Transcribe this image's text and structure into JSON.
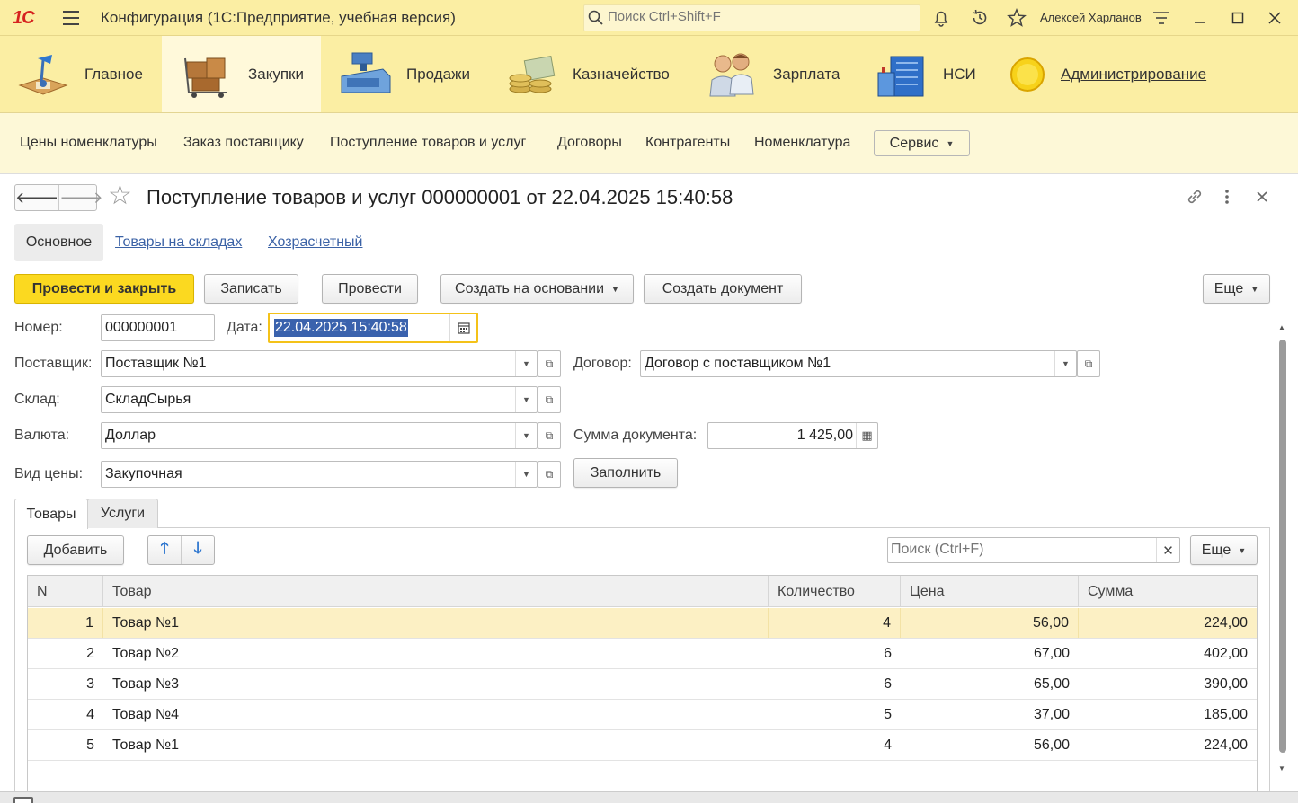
{
  "titlebar": {
    "logo": "1С",
    "title": "Конфигурация  (1С:Предприятие, учебная версия)",
    "search_placeholder": "Поиск Ctrl+Shift+F",
    "user": "Алексей Харланов"
  },
  "sections": [
    {
      "label": "Главное"
    },
    {
      "label": "Закупки"
    },
    {
      "label": "Продажи"
    },
    {
      "label": "Казначейство"
    },
    {
      "label": "Зарплата"
    },
    {
      "label": "НСИ"
    },
    {
      "label": "Администрирование"
    }
  ],
  "nav": {
    "links": [
      "Цены номенклатуры",
      "Заказ поставщику",
      "Поступление товаров и услуг",
      "Договоры",
      "Контрагенты",
      "Номенклатура"
    ],
    "service": "Сервис"
  },
  "form": {
    "title": "Поступление товаров и услуг 000000001 от 22.04.2025 15:40:58",
    "tabs": [
      "Основное",
      "Товары на складах",
      "Хозрасчетный"
    ],
    "buttons": {
      "post_close": "Провести и закрыть",
      "save": "Записать",
      "post": "Провести",
      "create_based": "Создать на основании",
      "create_doc": "Создать документ",
      "more": "Еще"
    },
    "fields": {
      "number_label": "Номер:",
      "number": "000000001",
      "date_label": "Дата:",
      "date": "22.04.2025 15:40:58",
      "supplier_label": "Поставщик:",
      "supplier": "Поставщик №1",
      "contract_label": "Договор:",
      "contract": "Договор с поставщиком №1",
      "warehouse_label": "Склад:",
      "warehouse": "СкладСырья",
      "currency_label": "Валюта:",
      "currency": "Доллар",
      "sum_label": "Сумма документа:",
      "sum": "1 425,00",
      "price_type_label": "Вид цены:",
      "price_type": "Закупочная",
      "fill": "Заполнить"
    },
    "bottom_tabs": [
      "Товары",
      "Услуги"
    ],
    "table_toolbar": {
      "add": "Добавить",
      "search_placeholder": "Поиск (Ctrl+F)",
      "more": "Еще"
    },
    "table": {
      "columns": [
        "N",
        "Товар",
        "Количество",
        "Цена",
        "Сумма"
      ],
      "rows": [
        [
          "1",
          "Товар №1",
          "4",
          "56,00",
          "224,00"
        ],
        [
          "2",
          "Товар №2",
          "6",
          "67,00",
          "402,00"
        ],
        [
          "3",
          "Товар №3",
          "6",
          "65,00",
          "390,00"
        ],
        [
          "4",
          "Товар №4",
          "5",
          "37,00",
          "185,00"
        ],
        [
          "5",
          "Товар №1",
          "4",
          "56,00",
          "224,00"
        ]
      ]
    }
  }
}
